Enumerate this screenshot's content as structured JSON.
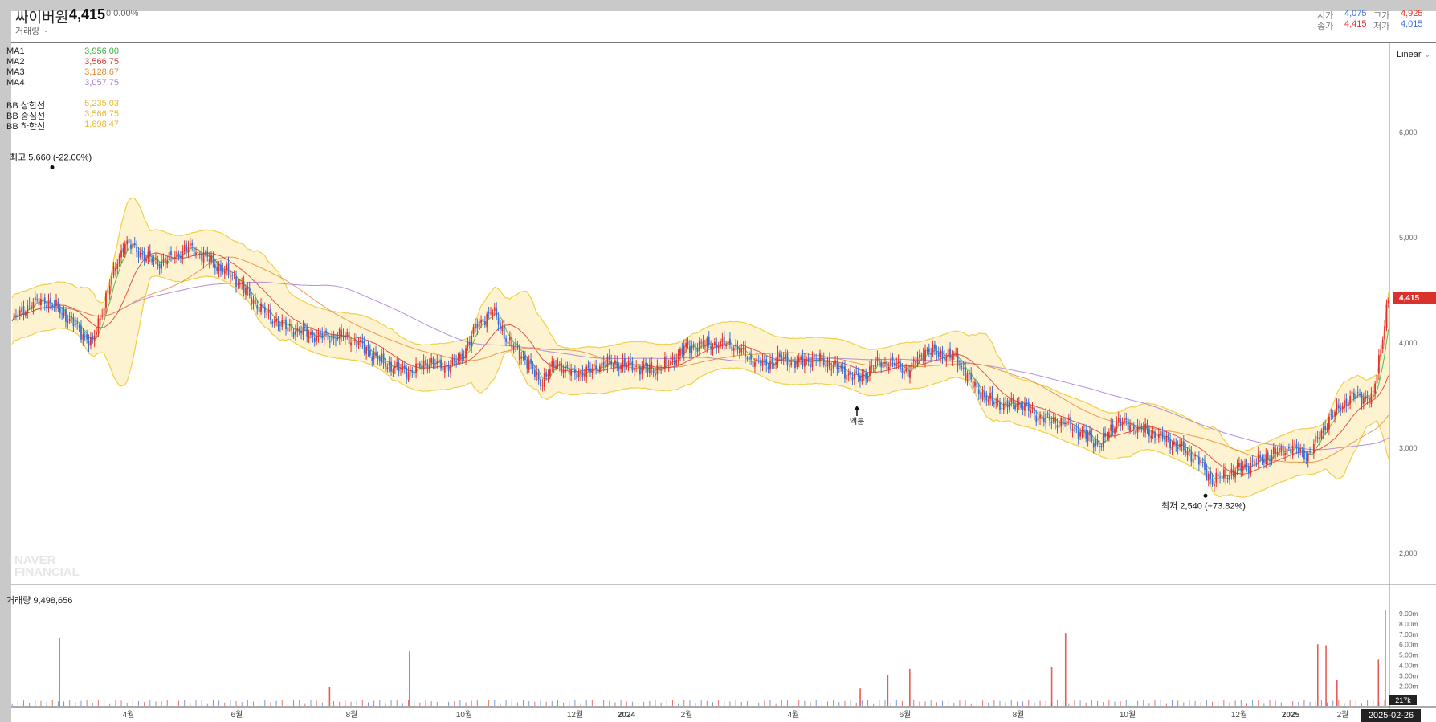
{
  "header": {
    "name": "싸이버원",
    "price": "4,415",
    "change": "0 0.00%",
    "volume_label": "거래량",
    "volume_value": "-",
    "ohlc": {
      "open_label": "시가",
      "open": "4,075",
      "high_label": "고가",
      "high": "4,925",
      "close_label": "종가",
      "close": "4,415",
      "low_label": "저가",
      "low": "4,015"
    }
  },
  "legend": [
    {
      "label": "MA1",
      "value": "3,956.00",
      "color": "#3cae3c"
    },
    {
      "label": "MA2",
      "value": "3,566.75",
      "color": "#e2322c"
    },
    {
      "label": "MA3",
      "value": "3,128.67",
      "color": "#e8893a"
    },
    {
      "label": "MA4",
      "value": "3,057.75",
      "color": "#a97ad8"
    },
    {
      "label": "BB 상한선",
      "value": "5,235.03",
      "color": "#e7b92f"
    },
    {
      "label": "BB 중심선",
      "value": "3,566.75",
      "color": "#e7b92f"
    },
    {
      "label": "BB 하한선",
      "value": "1,898.47",
      "color": "#e7b92f"
    }
  ],
  "annotations": {
    "max": "최고 5,660 (-22.00%)",
    "min": "최저 2,540 (+73.82%)",
    "event": "액분"
  },
  "axis_mode": "Linear",
  "price_tag": "4,415",
  "date_tag": "2025-02-26",
  "volume_tag": "217k",
  "volume_title": "거래량 9,498,656",
  "watermark": [
    "NAVER",
    "FINANCIAL"
  ],
  "colors": {
    "up": "#e2322c",
    "down": "#3a6fd8",
    "band": "#fdf3d0",
    "band_line": "#f0cf4a"
  },
  "chart_data": {
    "type": "candlestick",
    "y_ticks": [
      "6,000",
      "5,000",
      "4,000",
      "3,000",
      "2,000"
    ],
    "volume_ticks": [
      "9.00m",
      "8.00m",
      "7.00m",
      "6.00m",
      "5.00m",
      "4.00m",
      "3.00m",
      "2.00m"
    ],
    "x_ticks": [
      "4월",
      "6월",
      "8월",
      "10월",
      "12월",
      "2024",
      "2월",
      "4월",
      "6월",
      "8월",
      "10월",
      "12월",
      "2025",
      "2월"
    ],
    "close_path": [
      4200,
      4350,
      4400,
      4300,
      4150,
      3980,
      4500,
      4950,
      4850,
      4750,
      4800,
      4900,
      4820,
      4700,
      4600,
      4400,
      4250,
      4150,
      4100,
      4060,
      4050,
      4050,
      3950,
      3820,
      3750,
      3720,
      3820,
      3760,
      3840,
      4150,
      4300,
      4000,
      3850,
      3620,
      3800,
      3700,
      3720,
      3800,
      3790,
      3770,
      3730,
      3790,
      3940,
      3970,
      3980,
      3980,
      3850,
      3780,
      3850,
      3800,
      3840,
      3800,
      3720,
      3650,
      3800,
      3800,
      3720,
      3920,
      3890,
      3850,
      3600,
      3450,
      3400,
      3420,
      3300,
      3250,
      3220,
      3120,
      3020,
      3250,
      3200,
      3150,
      3080,
      3000,
      2900,
      2680,
      2750,
      2820,
      2880,
      2950,
      3000,
      2920,
      3200,
      3400,
      3500,
      3450,
      4415
    ],
    "max_point": 5660,
    "min_point": 2540,
    "vol_spikes": [
      {
        "x_frac": 0.035,
        "v": 6.6
      },
      {
        "x_frac": 0.231,
        "v": 1.8
      },
      {
        "x_frac": 0.289,
        "v": 5.3
      },
      {
        "x_frac": 0.616,
        "v": 1.7
      },
      {
        "x_frac": 0.636,
        "v": 3.0
      },
      {
        "x_frac": 0.652,
        "v": 3.6
      },
      {
        "x_frac": 0.755,
        "v": 3.8
      },
      {
        "x_frac": 0.765,
        "v": 7.1
      },
      {
        "x_frac": 0.948,
        "v": 6.0
      },
      {
        "x_frac": 0.954,
        "v": 5.9
      },
      {
        "x_frac": 0.962,
        "v": 2.5
      },
      {
        "x_frac": 0.992,
        "v": 4.5
      },
      {
        "x_frac": 0.997,
        "v": 9.3
      }
    ]
  }
}
